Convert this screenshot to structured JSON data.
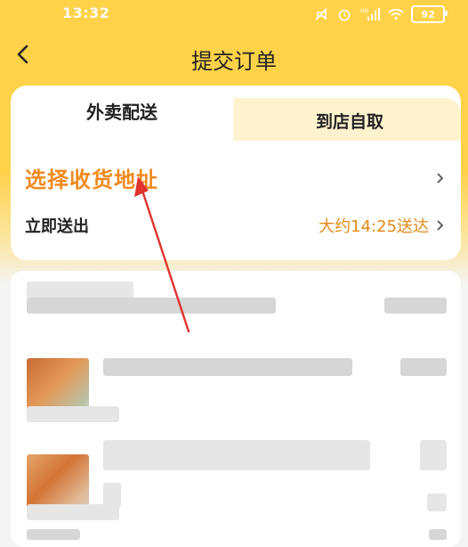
{
  "status_bar": {
    "time": "13:32",
    "battery": "92",
    "signal_badge": "HD"
  },
  "nav": {
    "title": "提交订单"
  },
  "tabs": [
    {
      "label": "外卖配送",
      "active": true
    },
    {
      "label": "到店自取",
      "active": false
    }
  ],
  "delivery": {
    "address_label": "选择收货地址",
    "time_label": "立即送出",
    "time_value": "大约14:25送达"
  },
  "colors": {
    "brand_yellow": "#ffd24a",
    "accent_orange": "#f08a1e",
    "annotation_red": "#e0332e"
  }
}
